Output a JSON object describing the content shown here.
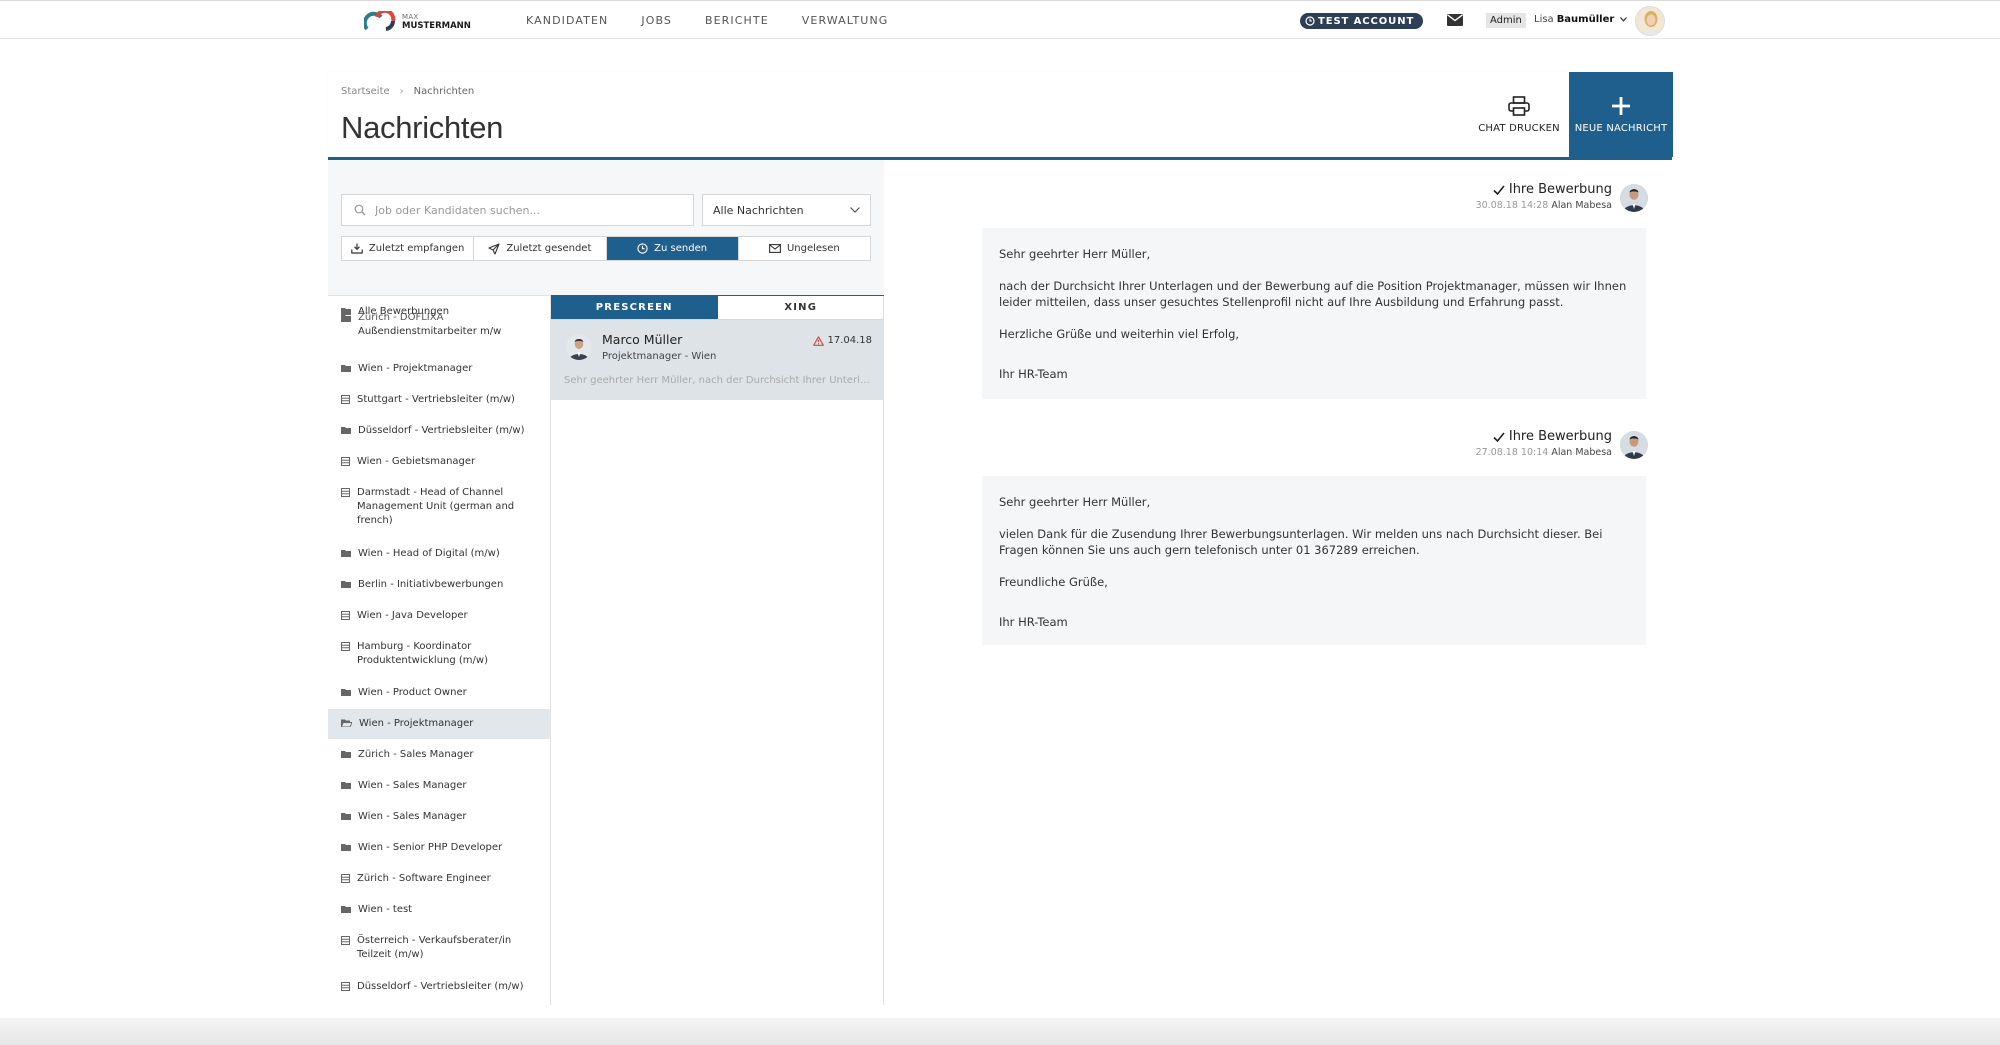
{
  "brand": {
    "line1": "MAX",
    "line2": "MUSTERMANN"
  },
  "nav": [
    "KANDIDATEN",
    "JOBS",
    "BERICHTE",
    "VERWALTUNG"
  ],
  "account": {
    "badge": "TEST ACCOUNT",
    "role": "Admin",
    "first_name": "Lisa",
    "last_name": "Baumüller"
  },
  "breadcrumb": {
    "home": "Startseite",
    "sep": "›",
    "current": "Nachrichten"
  },
  "page_title": "Nachrichten",
  "actions": {
    "print": "CHAT DRUCKEN",
    "new": "NEUE NACHRICHT"
  },
  "search": {
    "placeholder": "Job oder Kandidaten suchen...",
    "value": ""
  },
  "message_filter": {
    "selected": "Alle Nachrichten"
  },
  "filter_tabs": [
    {
      "label": "Zuletzt empfangen",
      "icon": "inbox-icon"
    },
    {
      "label": "Zuletzt gesendet",
      "icon": "send-icon"
    },
    {
      "label": "Zu senden",
      "icon": "clock-icon",
      "active": true
    },
    {
      "label": "Ungelesen",
      "icon": "envelope-icon"
    }
  ],
  "folders": [
    {
      "label": "Alle Bewerbungen",
      "icon": "folder-icon"
    },
    {
      "label": "Zürich - DOFLIXA Außendienstmitarbeiter m/w",
      "line1": "Zürich - DOFLIXA",
      "line2": "Außendienstmitarbeiter m/w",
      "icon": "folder-icon"
    },
    {
      "label": "Wien - Projektmanager",
      "icon": "folder-icon"
    },
    {
      "label": "Stuttgart - Vertriebsleiter (m/w)",
      "icon": "list-icon"
    },
    {
      "label": "Düsseldorf - Vertriebsleiter (m/w)",
      "icon": "folder-icon"
    },
    {
      "label": "Wien - Gebietsmanager",
      "icon": "list-icon"
    },
    {
      "label": "Darmstadt - Head of Channel Management Unit (german and french)",
      "line1": "Darmstadt - Head of Channel",
      "line2": "Management Unit (german and",
      "line3": "french)",
      "icon": "list-icon"
    },
    {
      "label": "Wien - Head of Digital (m/w)",
      "icon": "folder-icon"
    },
    {
      "label": "Berlin - Initiativbewerbungen",
      "icon": "folder-icon"
    },
    {
      "label": "Wien - Java Developer",
      "icon": "list-icon"
    },
    {
      "label": "Hamburg - Koordinator Produktentwicklung (m/w)",
      "line1": "Hamburg - Koordinator",
      "line2": "Produktentwicklung (m/w)",
      "icon": "list-icon"
    },
    {
      "label": "Wien - Product Owner",
      "icon": "folder-icon"
    },
    {
      "label": "Wien - Projektmanager",
      "icon": "folder-open-icon",
      "active": true
    },
    {
      "label": "Zürich - Sales Manager",
      "icon": "folder-icon"
    },
    {
      "label": "Wien - Sales Manager",
      "icon": "folder-icon"
    },
    {
      "label": "Wien - Sales Manager",
      "icon": "folder-icon"
    },
    {
      "label": "Wien - Senior PHP Developer",
      "icon": "folder-icon"
    },
    {
      "label": "Zürich - Software Engineer",
      "icon": "list-icon"
    },
    {
      "label": "Wien - test",
      "icon": "folder-icon"
    },
    {
      "label": "Österreich - Verkaufsberater/in Teilzeit (m/w)",
      "line1": "Österreich - Verkaufsberater/in",
      "line2": "Teilzeit (m/w)",
      "icon": "list-icon"
    },
    {
      "label": "Düsseldorf - Vertriebsleiter (m/w)",
      "icon": "list-icon"
    }
  ],
  "channel_tabs": [
    {
      "label": "PRESCREEN",
      "active": true
    },
    {
      "label": "XING"
    }
  ],
  "conversation": {
    "name": "Marco Müller",
    "role": "Projektmanager - Wien",
    "date": "17.04.18",
    "preview": "Sehr geehrter Herr Müller, nach der Durchsicht Ihrer Unterlagen und der Bewerbung auf die Position Projektmanager..."
  },
  "messages": [
    {
      "subject": "Ihre Bewerbung",
      "timestamp": "30.08.18 14:28",
      "sender": "Alan Mabesa",
      "greeting": "Sehr geehrter Herr Müller,",
      "body": "nach der Durchsicht Ihrer Unterlagen und der Bewerbung auf die Position Projektmanager, müssen wir Ihnen leider mitteilen, dass unser gesuchtes Stellenprofil nicht auf Ihre Ausbildung und Erfahrung passt.",
      "closing": "Herzliche Grüße und weiterhin viel Erfolg,",
      "signature": "Ihr HR-Team"
    },
    {
      "subject": "Ihre Bewerbung",
      "timestamp": "27.08.18 10:14",
      "sender": "Alan Mabesa",
      "greeting": "Sehr geehrter Herr Müller,",
      "body": "vielen Dank für die Zusendung Ihrer Bewerbungsunterlagen. Wir melden uns nach Durchsicht dieser. Bei Fragen können Sie uns auch gern telefonisch unter 01 367289 erreichen.",
      "closing": "Freundliche Grüße,",
      "signature": "Ihr HR-Team"
    }
  ],
  "colors": {
    "primary": "#1e5f8e",
    "badge": "#2e3e55",
    "active_row": "#dde3e7",
    "panel": "#f5f7f8"
  }
}
